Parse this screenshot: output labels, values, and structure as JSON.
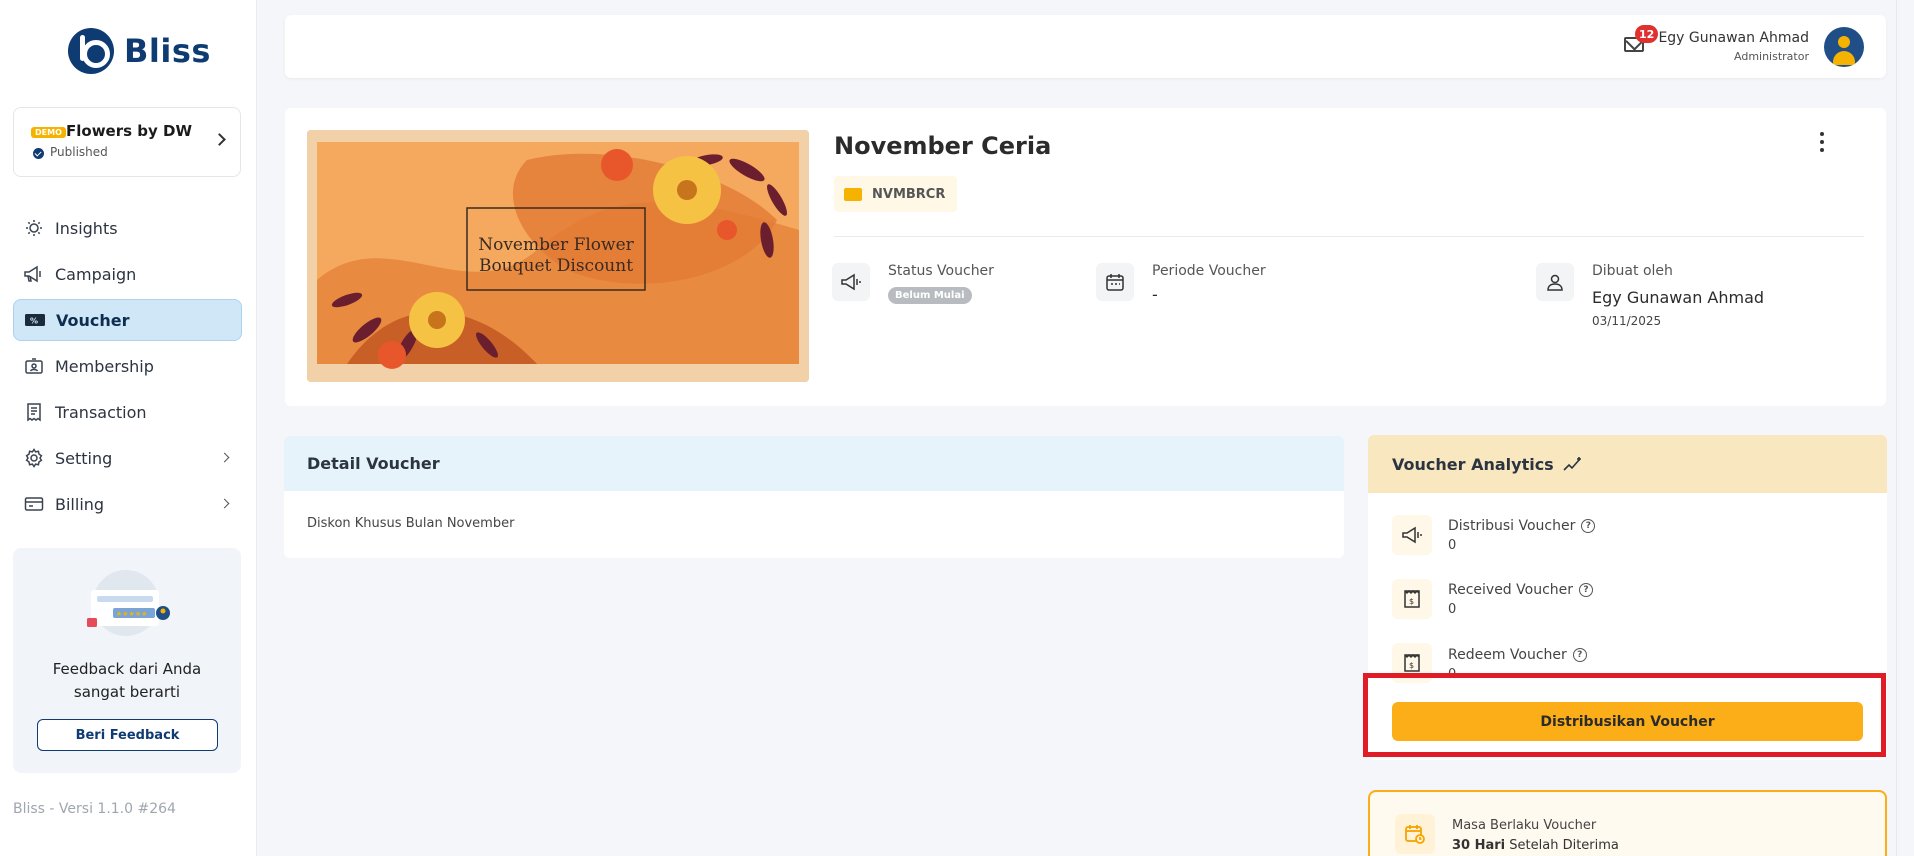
{
  "brand": {
    "name": "Bliss",
    "color": "#0f3b73",
    "accent": "#fbae17"
  },
  "store": {
    "badge": "DEMO",
    "name": "Flowers by DW",
    "status": "Published"
  },
  "sidebar": {
    "items": [
      {
        "label": "Insights",
        "icon": "insights-icon"
      },
      {
        "label": "Campaign",
        "icon": "megaphone-icon"
      },
      {
        "label": "Voucher",
        "icon": "voucher-icon",
        "active": true
      },
      {
        "label": "Membership",
        "icon": "membership-icon"
      },
      {
        "label": "Transaction",
        "icon": "receipt-icon"
      },
      {
        "label": "Setting",
        "icon": "gear-icon",
        "expandable": true
      },
      {
        "label": "Billing",
        "icon": "card-icon",
        "expandable": true
      }
    ]
  },
  "feedback": {
    "text_line1": "Feedback dari Anda",
    "text_line2": "sangat berarti",
    "button": "Beri Feedback"
  },
  "version": "Bliss - Versi 1.1.0 #264",
  "topbar": {
    "mail_count": "12",
    "user_name": "Egy Gunawan Ahmad",
    "user_role": "Administrator"
  },
  "voucher": {
    "title": "November Ceria",
    "code": "NVMBRCR",
    "banner": {
      "title_line1": "November Flower",
      "title_line2": "Bouquet Discount"
    },
    "status_label": "Status Voucher",
    "status_value": "Belum Mulai",
    "period_label": "Periode Voucher",
    "period_value": "-",
    "creator_label": "Dibuat oleh",
    "creator_name": "Egy Gunawan Ahmad",
    "created_date": "03/11/2025"
  },
  "detail": {
    "title": "Detail Voucher",
    "description": "Diskon Khusus Bulan November"
  },
  "analytics": {
    "title": "Voucher Analytics",
    "stats": [
      {
        "label": "Distribusi Voucher",
        "value": "0"
      },
      {
        "label": "Received Voucher",
        "value": "0"
      },
      {
        "label": "Redeem Voucher",
        "value": "0"
      }
    ],
    "button": "Distribusikan Voucher"
  },
  "validity": {
    "label": "Masa Berlaku Voucher",
    "value_bold": "30 Hari",
    "value_rest": " Setelah Diterima"
  }
}
